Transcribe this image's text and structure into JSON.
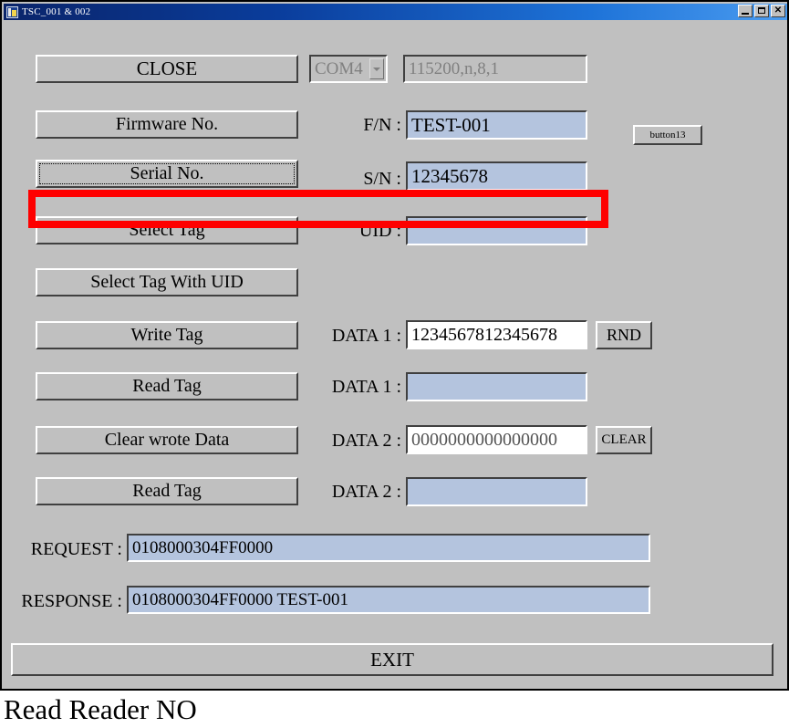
{
  "window": {
    "title": "TSC_001 & 002",
    "icon": "app-icon",
    "controls": {
      "minimize": "minimize-icon",
      "maximize": "maximize-icon",
      "close": "close-icon"
    }
  },
  "toolbar": {
    "close_label": "CLOSE",
    "port": {
      "value": "COM4",
      "arrow": "chevron-down-icon"
    },
    "serial_settings": "115200,n,8,1"
  },
  "rows": [
    {
      "button": "Firmware No.",
      "label": "F/N :",
      "value": "TEST-001"
    },
    {
      "button": "Serial No.",
      "label": "S/N :",
      "value": "12345678"
    },
    {
      "button": "Select Tag",
      "label": "UID :",
      "value": ""
    },
    {
      "button": "Select Tag With UID",
      "label": "",
      "value": ""
    },
    {
      "button": "Write Tag",
      "label": "DATA 1 :",
      "value": "1234567812345678",
      "side_button": "RND"
    },
    {
      "button": "Read Tag",
      "label": "DATA 1 :",
      "value": ""
    },
    {
      "button": "Clear wrote Data",
      "label": "DATA 2 :",
      "value": "0000000000000000",
      "side_button": "CLEAR"
    },
    {
      "button": "Read Tag",
      "label": "DATA 2 :",
      "value": ""
    }
  ],
  "extra_button": {
    "label": "button13"
  },
  "log": {
    "request_label": "REQUEST :",
    "request_value": "0108000304FF0000",
    "response_label": "RESPONSE :",
    "response_value": "0108000304FF0000  TEST-001"
  },
  "exit": {
    "label": "EXIT"
  },
  "annotation": {
    "highlight_color": "#fe0000",
    "caption": "Read Reader NO"
  }
}
